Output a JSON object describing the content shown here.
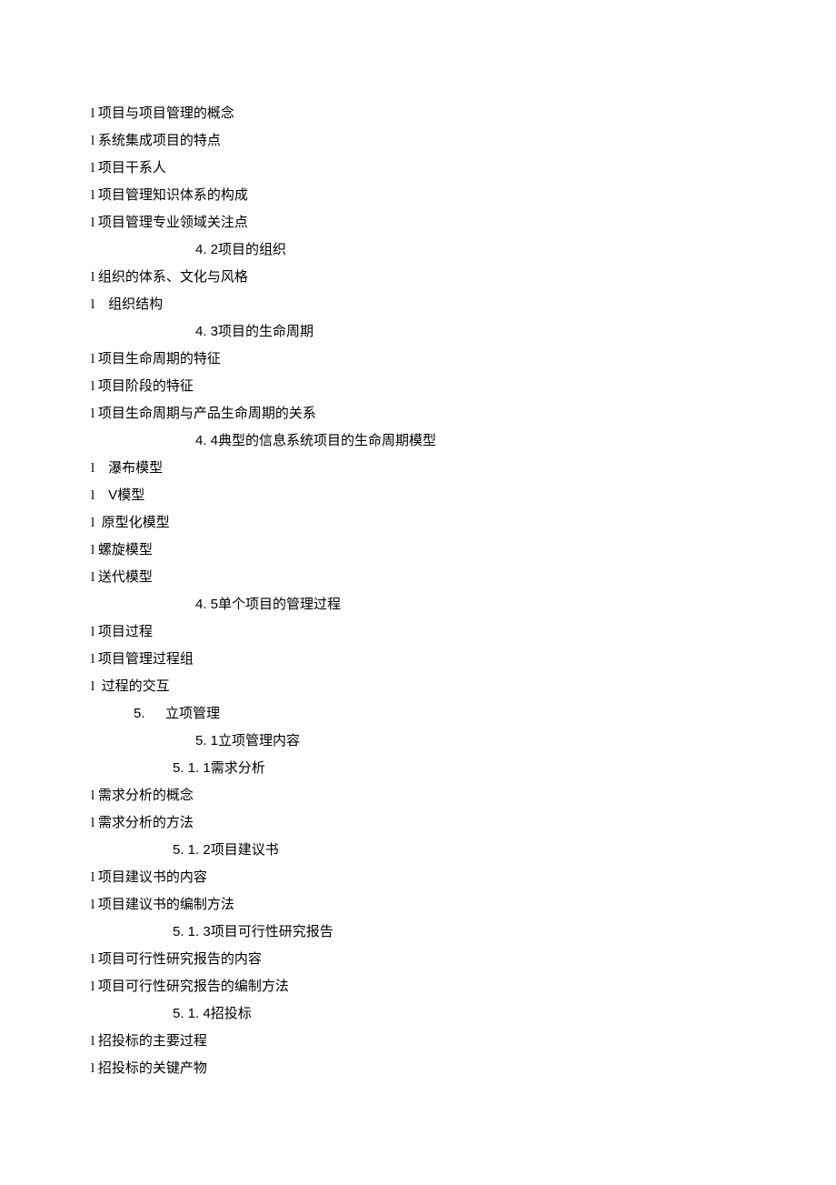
{
  "lines": [
    {
      "type": "bullet",
      "text": "项目与项目管理的概念"
    },
    {
      "type": "bullet",
      "text": "系统集成项目的特点"
    },
    {
      "type": "bullet",
      "text": "项目干系人"
    },
    {
      "type": "bullet",
      "text": "项目管理知识体系的构成"
    },
    {
      "type": "bullet",
      "text": "项目管理专业领域关注点"
    },
    {
      "type": "h2",
      "num": "4. 2",
      "text": "项目的组织"
    },
    {
      "type": "bullet",
      "text": "组织的体系、文化与风格"
    },
    {
      "type": "bullet-sp",
      "text": "组织结构"
    },
    {
      "type": "h2",
      "num": "4. 3",
      "text": "项目的生命周期"
    },
    {
      "type": "bullet",
      "text": "项目生命周期的特征"
    },
    {
      "type": "bullet",
      "text": "项目阶段的特征"
    },
    {
      "type": "bullet",
      "text": "项目生命周期与产品生命周期的关系"
    },
    {
      "type": "h2",
      "num": "4. 4",
      "text": "典型的信息系统项目的生命周期模型"
    },
    {
      "type": "bullet-sp",
      "text": "瀑布模型"
    },
    {
      "type": "bullet-sp2",
      "num": "V",
      "text": "模型"
    },
    {
      "type": "bullet-sp3",
      "text": "原型化模型"
    },
    {
      "type": "bullet",
      "text": "螺旋模型"
    },
    {
      "type": "bullet",
      "text": "送代模型"
    },
    {
      "type": "h2",
      "num": "4. 5",
      "text": "单个项目的管理过程"
    },
    {
      "type": "bullet",
      "text": "项目过程"
    },
    {
      "type": "bullet",
      "text": "项目管理过程组"
    },
    {
      "type": "bullet-sp3",
      "text": "过程的交互"
    },
    {
      "type": "h1",
      "num": "5.",
      "text": "立项管理"
    },
    {
      "type": "h2",
      "num": "5. 1",
      "text": "立项管理内容"
    },
    {
      "type": "h3",
      "num": "5. 1. 1",
      "text": "需求分析"
    },
    {
      "type": "bullet",
      "text": "需求分析的概念"
    },
    {
      "type": "bullet",
      "text": "需求分析的方法"
    },
    {
      "type": "h3",
      "num": "5. 1. 2",
      "text": "项目建议书"
    },
    {
      "type": "bullet",
      "text": "项目建议书的内容"
    },
    {
      "type": "bullet",
      "text": "项目建议书的编制方法"
    },
    {
      "type": "h3",
      "num": "5. 1. 3",
      "text": "项目可行性研究报告"
    },
    {
      "type": "bullet",
      "text": "项目可行性研究报告的内容"
    },
    {
      "type": "bullet",
      "text": "项目可行性研究报告的编制方法"
    },
    {
      "type": "h3",
      "num": "5. 1. 4",
      "text": "招投标"
    },
    {
      "type": "bullet",
      "text": "招投标的主要过程"
    },
    {
      "type": "bullet",
      "text": "招投标的关键产物"
    }
  ]
}
